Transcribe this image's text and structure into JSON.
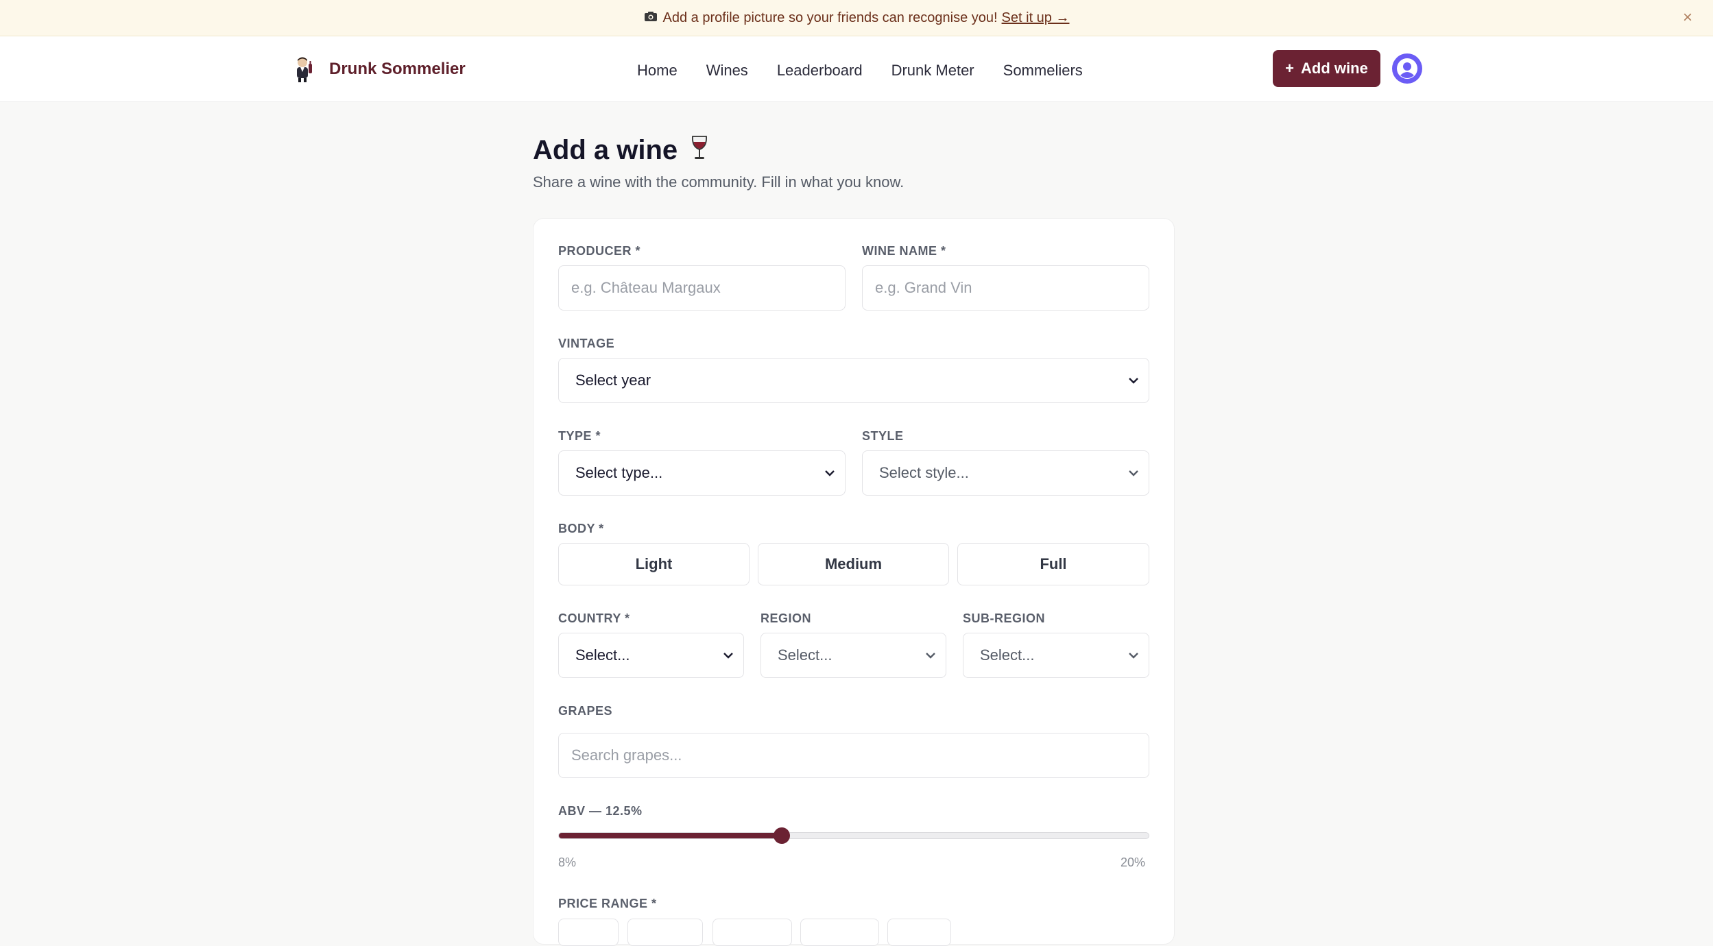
{
  "banner": {
    "text": "Add a profile picture so your friends can recognise you!",
    "link": "Set it up →",
    "close": "×"
  },
  "nav": {
    "brand": "Drunk Sommelier",
    "links": [
      "Home",
      "Wines",
      "Leaderboard",
      "Drunk Meter",
      "Sommeliers"
    ],
    "add_button": "Add wine",
    "add_button_icon": "+"
  },
  "page": {
    "title": "Add a wine",
    "title_emoji": "🍷",
    "subtitle": "Share a wine with the community. Fill in what you know."
  },
  "form": {
    "producer": {
      "label": "PRODUCER *",
      "placeholder": "e.g. Château Margaux"
    },
    "wine_name": {
      "label": "WINE NAME *",
      "placeholder": "e.g. Grand Vin"
    },
    "vintage": {
      "label": "VINTAGE",
      "value": "Select year"
    },
    "type": {
      "label": "TYPE *",
      "value": "Select type..."
    },
    "style": {
      "label": "STYLE",
      "value": "Select style..."
    },
    "body": {
      "label": "BODY *",
      "options": [
        "Light",
        "Medium",
        "Full"
      ]
    },
    "country": {
      "label": "COUNTRY *",
      "value": "Select..."
    },
    "region": {
      "label": "REGION",
      "value": "Select..."
    },
    "sub_region": {
      "label": "SUB-REGION",
      "value": "Select..."
    },
    "grapes": {
      "label": "GRAPES",
      "placeholder": "Search grapes..."
    },
    "abv": {
      "label": "ABV — 12.5%",
      "value": 12.5,
      "min": 8,
      "max": 20,
      "min_label": "8%",
      "max_label": "20%"
    },
    "price_range": {
      "label": "PRICE RANGE *"
    }
  },
  "colors": {
    "accent": "#6b2233",
    "avatar": "#6b5cf5",
    "banner_bg": "#fdf8ea"
  }
}
